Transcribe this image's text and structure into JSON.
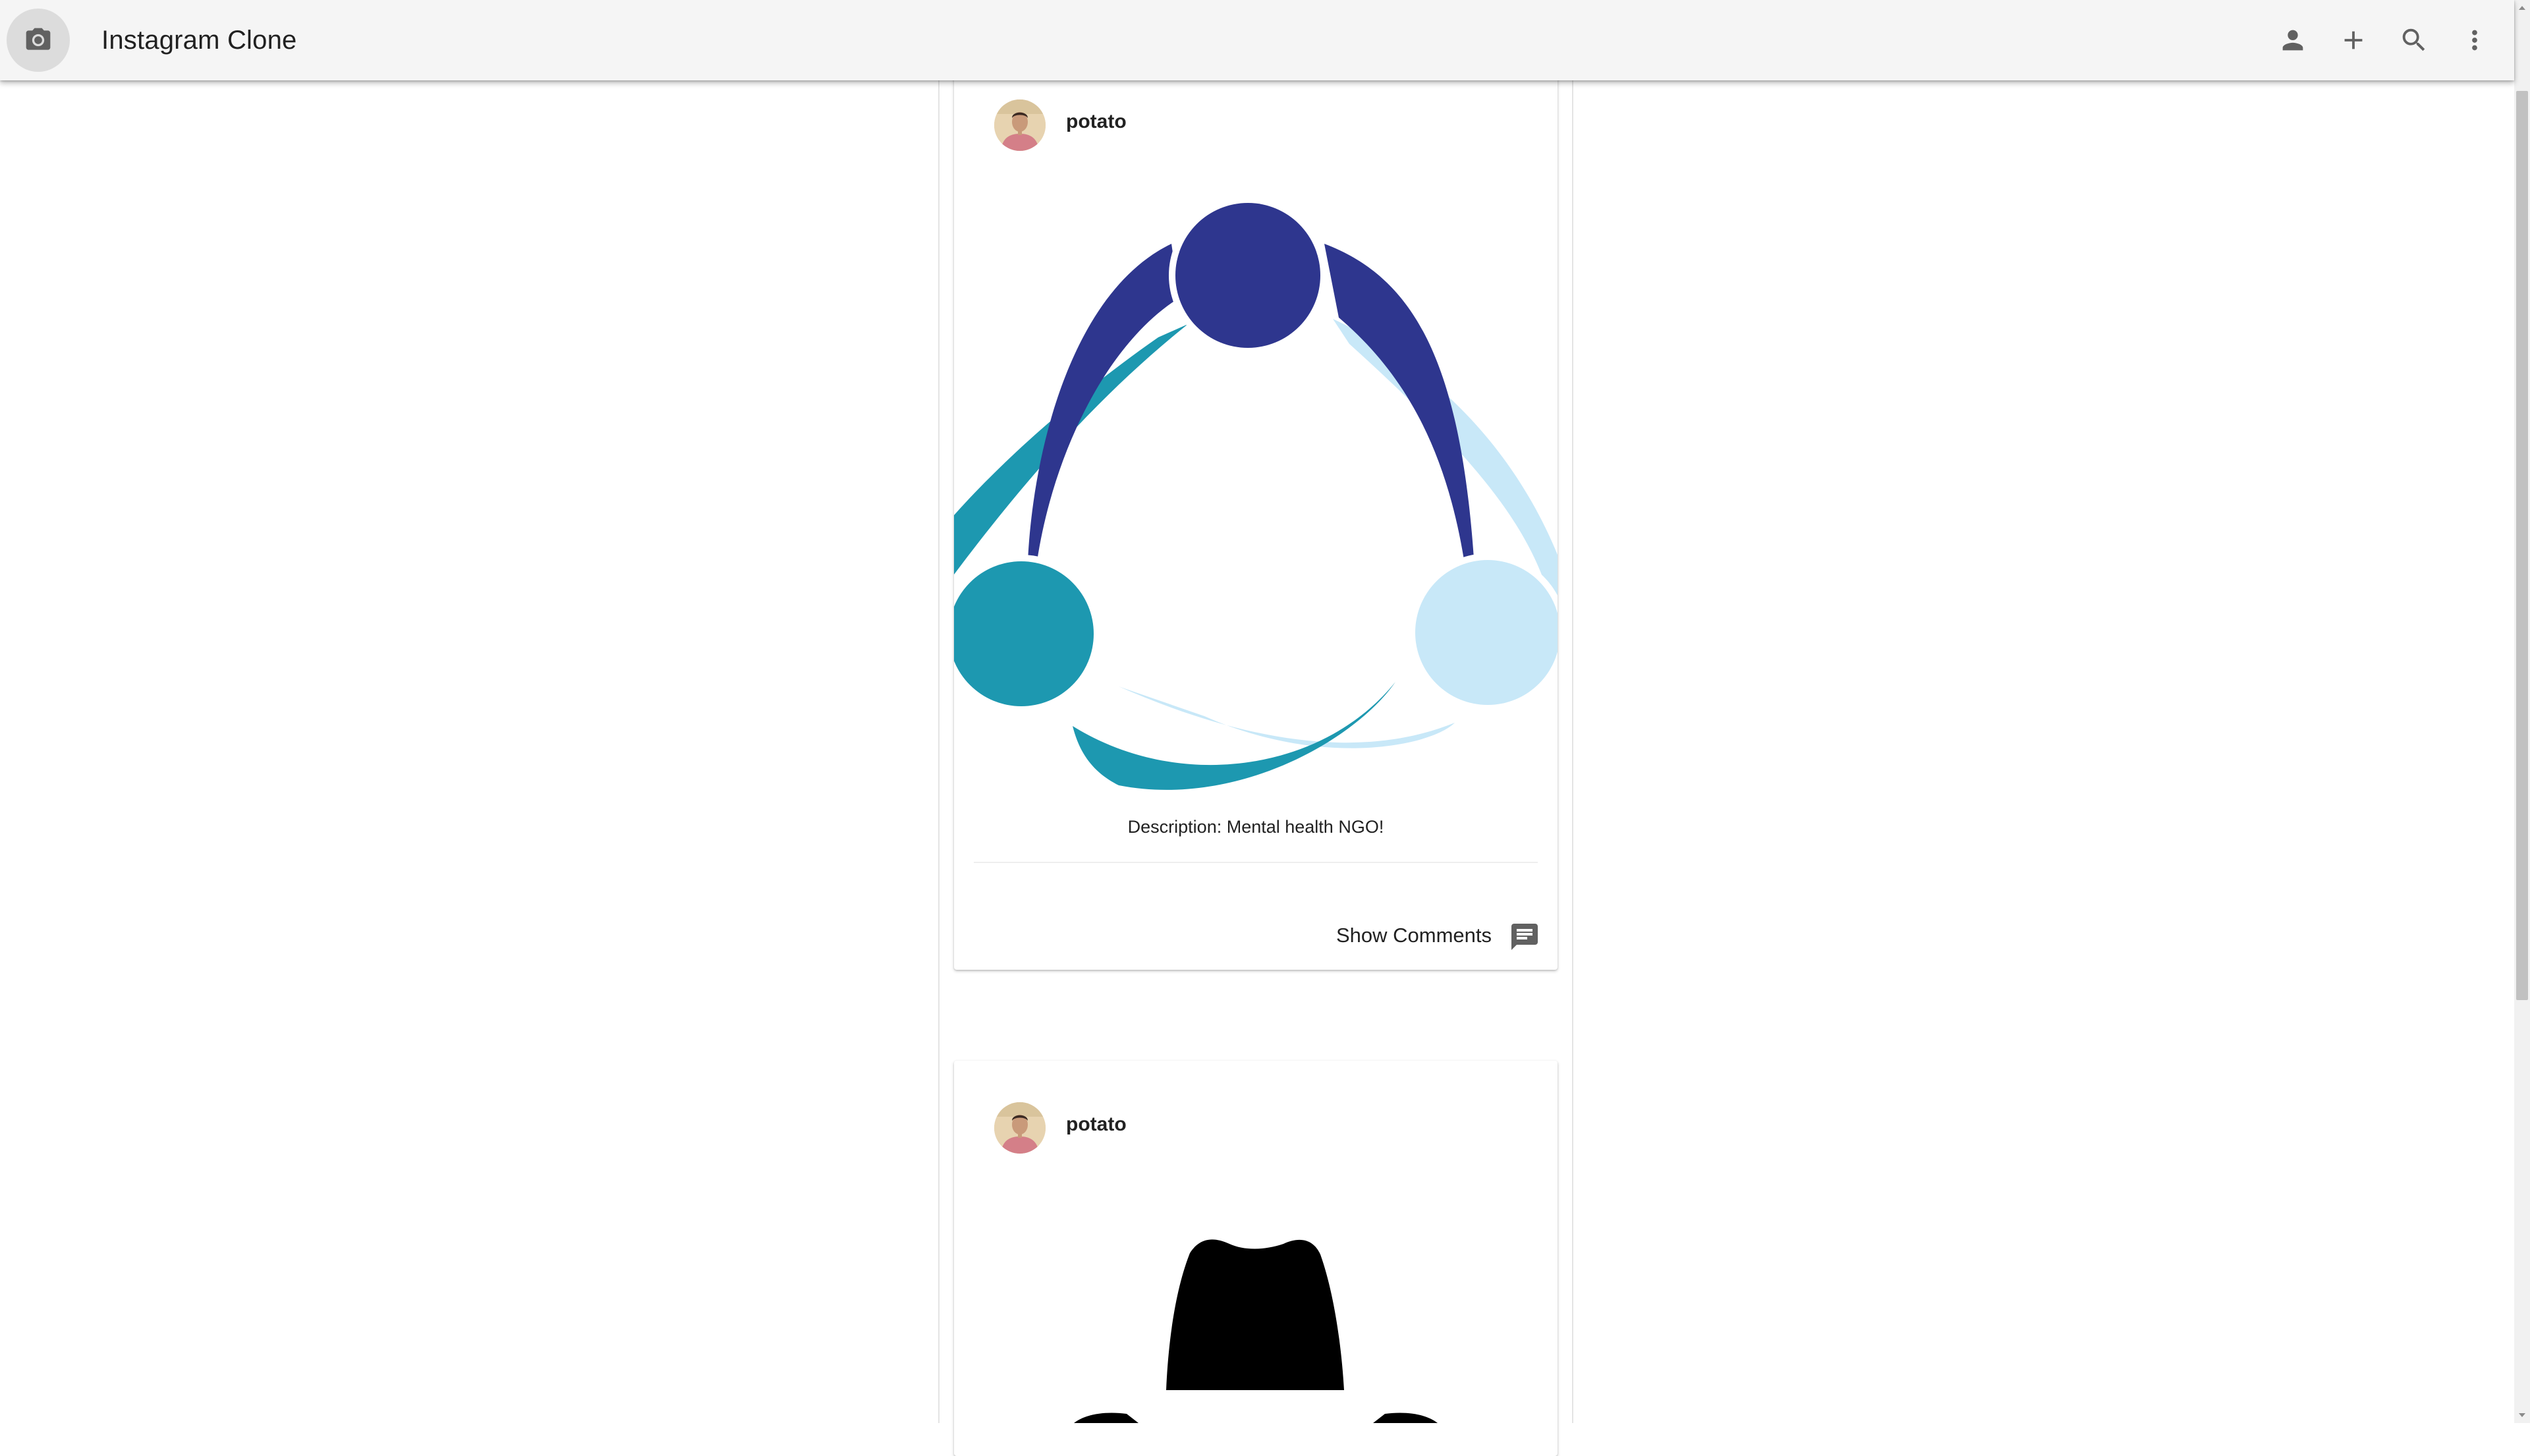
{
  "app": {
    "title": "Instagram Clone"
  },
  "toolbar": {
    "logo_icon": "camera-icon",
    "actions": [
      "person-icon",
      "add-icon",
      "search-icon",
      "more-vert-icon"
    ]
  },
  "posts": [
    {
      "username": "potato",
      "image": "ngo-three-people-circle-logo",
      "description": "Description: Mental health NGO!",
      "show_comments_label": "Show Comments"
    },
    {
      "username": "potato",
      "image": "fedora-hat-silhouette"
    }
  ],
  "colors": {
    "appbar": "#f5f5f5",
    "logo_dark_blue": "#2e368e",
    "logo_teal": "#1d98b0",
    "logo_light_blue": "#c8e8f8"
  }
}
